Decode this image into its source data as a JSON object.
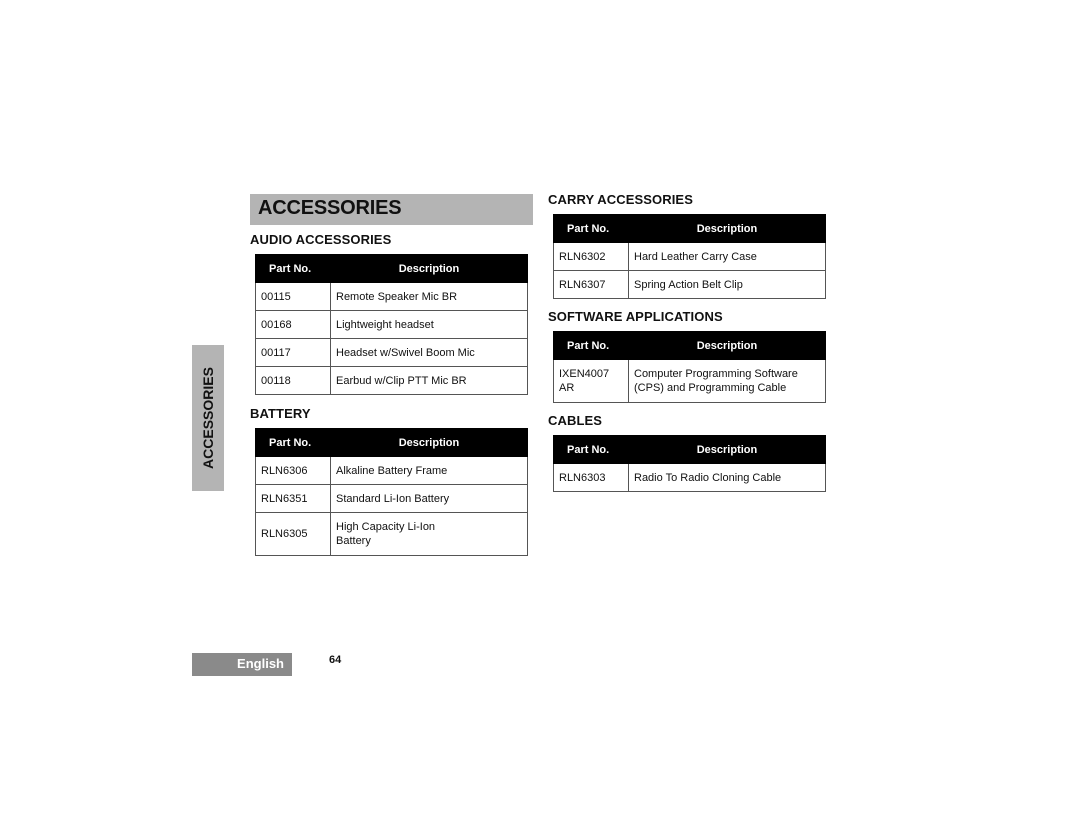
{
  "page_title": "ACCESSORIES",
  "side_tab": "ACCESSORIES",
  "table_headers": {
    "part_no": "Part No.",
    "description": "Description"
  },
  "sections": {
    "audio": {
      "heading": "AUDIO ACCESSORIES",
      "rows": [
        {
          "part": "00115",
          "desc": "Remote Speaker Mic BR"
        },
        {
          "part": "00168",
          "desc": "Lightweight headset"
        },
        {
          "part": "00117",
          "desc": "Headset w/Swivel Boom Mic"
        },
        {
          "part": "00118",
          "desc": "Earbud w/Clip PTT Mic BR"
        }
      ]
    },
    "battery": {
      "heading": "BATTERY",
      "rows": [
        {
          "part": "RLN6306",
          "desc": "Alkaline Battery Frame"
        },
        {
          "part": "RLN6351",
          "desc": "Standard Li-Ion Battery"
        },
        {
          "part": "RLN6305",
          "desc": "High Capacity Li-Ion Battery"
        }
      ]
    },
    "carry": {
      "heading": "CARRY ACCESSORIES",
      "rows": [
        {
          "part": "RLN6302",
          "desc": "Hard Leather Carry Case"
        },
        {
          "part": "RLN6307",
          "desc": "Spring Action Belt Clip"
        }
      ]
    },
    "software": {
      "heading": "SOFTWARE APPLICATIONS",
      "rows": [
        {
          "part": "IXEN4007 AR",
          "desc": "Computer Programming Software (CPS) and Programming Cable"
        }
      ]
    },
    "cables": {
      "heading": "CABLES",
      "rows": [
        {
          "part": "RLN6303",
          "desc": "Radio To Radio Cloning Cable"
        }
      ]
    }
  },
  "footer": {
    "language": "English",
    "page_number": "64"
  }
}
